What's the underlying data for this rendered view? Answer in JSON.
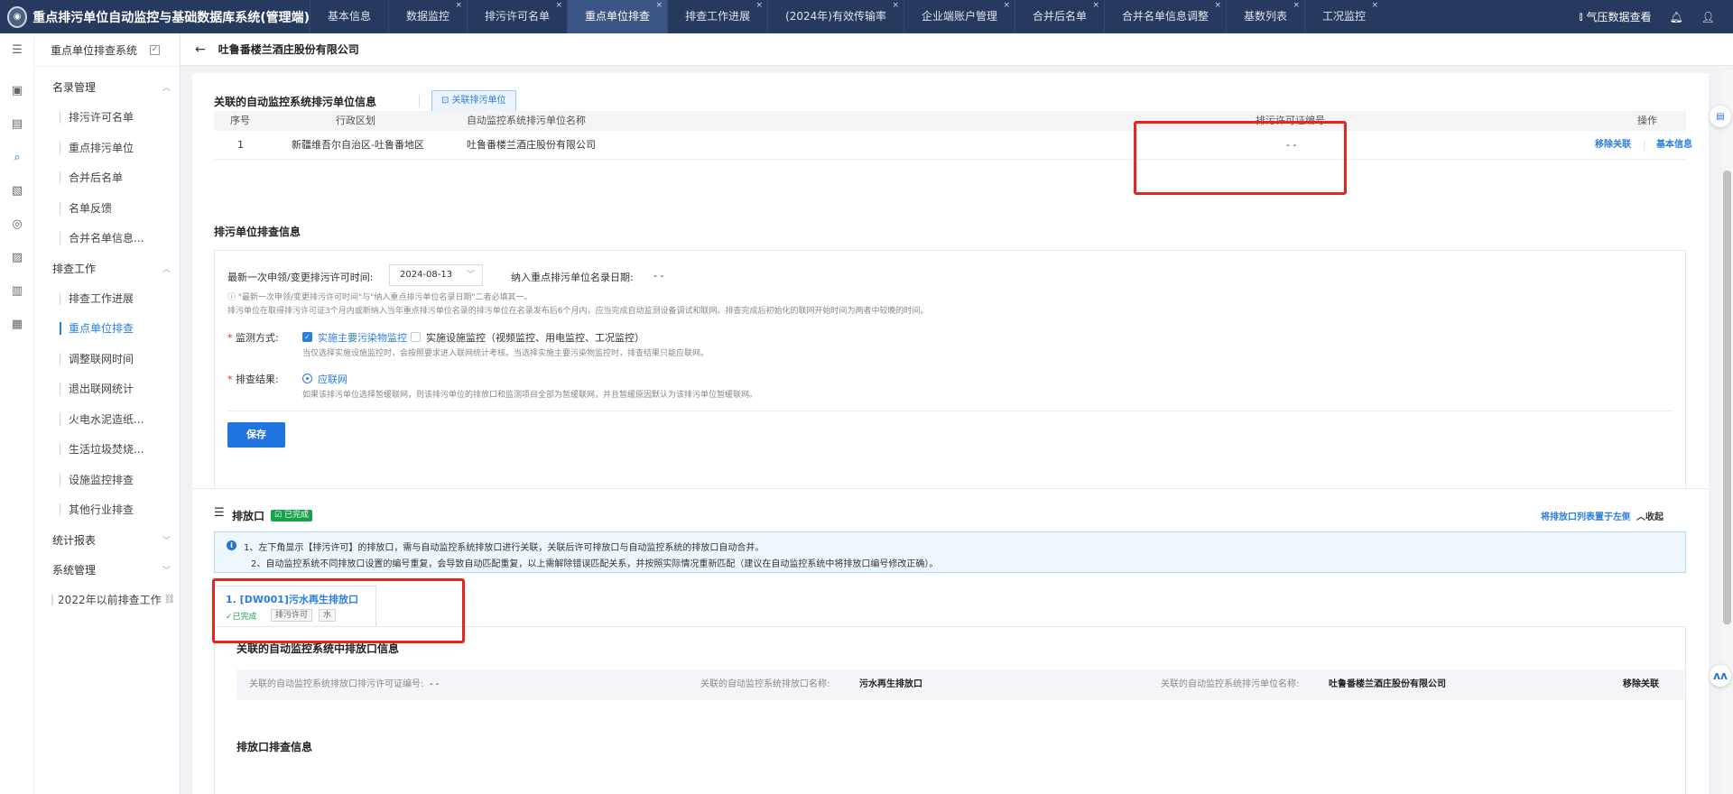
{
  "header": {
    "app_title": "重点排污单位自动监控与基础数据库系统(管理端)",
    "tabs": [
      {
        "label": "基本信息",
        "closable": false
      },
      {
        "label": "数据监控",
        "closable": true
      },
      {
        "label": "排污许可名单",
        "closable": true
      },
      {
        "label": "重点单位排查",
        "closable": true,
        "active": true
      },
      {
        "label": "排查工作进展",
        "closable": true
      },
      {
        "label": "(2024年)有效传输率",
        "closable": true
      },
      {
        "label": "企业端账户管理",
        "closable": true
      },
      {
        "label": "合并后名单",
        "closable": true
      },
      {
        "label": "合并名单信息调整",
        "closable": true
      },
      {
        "label": "基数列表",
        "closable": true
      },
      {
        "label": "工况监控",
        "closable": true
      }
    ],
    "right_link": "气压数据查看",
    "close_glyph": "×"
  },
  "sidebar": {
    "system_name": "重点单位排查系统",
    "groups": [
      {
        "label": "名录管理",
        "items": [
          "排污许可名单",
          "重点排污单位",
          "合并后名单",
          "名单反馈",
          "合并名单信息..."
        ]
      },
      {
        "label": "排查工作",
        "items": [
          "排查工作进展",
          "重点单位排查",
          "调整联网时间",
          "退出联网统计",
          "火电水泥造纸...",
          "生活垃圾焚烧...",
          "设施监控排查",
          "其他行业排查"
        ]
      },
      {
        "label": "统计报表",
        "items": []
      },
      {
        "label": "系统管理",
        "items": []
      }
    ],
    "active_item": "重点单位排查",
    "legacy_link": "2022年以前排查工作"
  },
  "breadcrumb": {
    "title": "吐鲁番楼兰酒庄股份有限公司"
  },
  "linked_units": {
    "title": "关联的自动监控系统排污单位信息",
    "link_button": "关联排污单位",
    "columns": [
      "序号",
      "行政区划",
      "自动监控系统排污单位名称",
      "排污许可证编号",
      "操作"
    ],
    "rows": [
      {
        "index": "1",
        "region": "新疆维吾尔自治区-吐鲁番地区",
        "name": "吐鲁番楼兰酒庄股份有限公司",
        "permit_no": "- -",
        "actions": [
          "移除关联",
          "基本信息"
        ]
      }
    ]
  },
  "inspection": {
    "title": "排污单位排查信息",
    "last_apply_label": "最新一次申领/变更排污许可时间:",
    "last_apply_date": "2024-08-13",
    "include_date_label": "纳入重点排污单位名录日期:",
    "include_date_value": "- -",
    "note_line1": "ⓘ \"最新一次申领/变更排污许可时间\"与\"纳入重点排污单位名录日期\"二者必填其一。",
    "note_line2": "排污单位在取得排污许可证3个月内或新纳入当年重点排污单位名录的排污单位在名录发布后6个月内，应当完成自动监测设备调试和联网。排查完成后初始化的联网开始时间为两者中较晚的时间。",
    "monitor_label": "监测方式:",
    "monitor_option1": "实施主要污染物监控",
    "monitor_option2": "实施设施监控（视频监控、用电监控、工况监控）",
    "monitor_hint": "当仅选择实施设施监控时，会按照要求进入联网统计考核。当选择实施主要污染物监控时，排查结果只能应联网。",
    "result_label": "排查结果:",
    "result_option": "应联网",
    "result_hint": "如果该排污单位选择暂缓联网，则该排污单位的排放口和监测项目全部为暂缓联网，并且暂缓原因默认为该排污单位暂缓联网。",
    "save_button": "保存",
    "required_mark": "*"
  },
  "outlets": {
    "title": "排放口",
    "status_badge": "已完成",
    "move_left_link": "将排放口列表置于左侧",
    "collapse_link": "收起",
    "notice_line1": "1、左下角显示【排污许可】的排放口，需与自动监控系统排放口进行关联，关联后许可排放口与自动监控系统的排放口自动合并。",
    "notice_line2": "2、自动监控系统不同排放口设置的编号重复，会导致自动匹配重复，以上需解除错误匹配关系，并按照实际情况重新匹配（建议在自动监控系统中将排放口编号修改正确）。",
    "tab": {
      "label": "1. [DW001]污水再生排放口",
      "status": "已完成",
      "tags": [
        "排污许可",
        "水"
      ]
    },
    "linked": {
      "title": "关联的自动监控系统中排放口信息",
      "permit_label": "关联的自动监控系统排放口排污许可证编号:",
      "permit_value": "- -",
      "name_label": "关联的自动监控系统排放口名称:",
      "name_value": "污水再生排放口",
      "unit_label": "关联的自动监控系统排污单位名称:",
      "unit_value": "吐鲁番楼兰酒庄股份有限公司",
      "remove_link": "移除关联"
    },
    "next_section_title": "排放口排查信息"
  },
  "colors": {
    "topbar": "#253a5e",
    "accent": "#1f74e0",
    "success": "#17a34a",
    "highlight": "#e8241f"
  }
}
